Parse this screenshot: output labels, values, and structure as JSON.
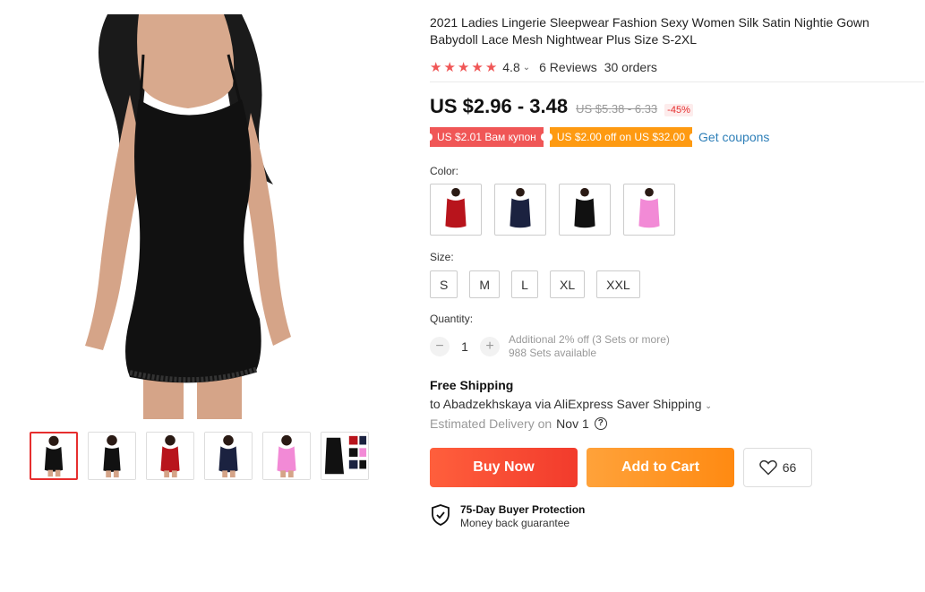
{
  "product": {
    "title": "2021 Ladies Lingerie Sleepwear Fashion Sexy Women Silk Satin Nightie Gown Babydoll Lace Mesh Nightwear Plus Size S-2XL",
    "rating": 4.8,
    "rating_text": "4.8",
    "rating_chevron": "⌄",
    "reviews": "6 Reviews",
    "orders": "30 orders",
    "price": "US $2.96 - 3.48",
    "old_price": "US $5.38 - 6.33",
    "discount": "-45%"
  },
  "coupons": {
    "red": "US $2.01 Вам купон",
    "orange": "US $2.00 off on US $32.00",
    "get": "Get coupons"
  },
  "color": {
    "label": "Color:",
    "options": [
      "red",
      "navy",
      "black",
      "pink"
    ]
  },
  "size": {
    "label": "Size:",
    "options": [
      "S",
      "M",
      "L",
      "XL",
      "XXL"
    ]
  },
  "quantity": {
    "label": "Quantity:",
    "minus": "−",
    "value": "1",
    "plus": "+",
    "note1": "Additional 2% off (3 Sets or more)",
    "note2": "988 Sets available"
  },
  "shipping": {
    "title": "Free Shipping",
    "to": "to Abadzekhskaya via AliExpress Saver Shipping",
    "chevron": "⌄",
    "delivery_label": "Estimated Delivery on",
    "delivery_date": "Nov 1",
    "help": "?"
  },
  "actions": {
    "buy": "Buy Now",
    "cart": "Add to Cart",
    "wishlist_count": "66"
  },
  "protection": {
    "title": "75-Day Buyer Protection",
    "subtitle": "Money back guarantee"
  },
  "colors": {
    "accent_red": "#f05656",
    "coupon_orange": "#fe9a11",
    "link_blue": "#2e7fb8",
    "dress_black": "#111111",
    "dress_red": "#b8141c",
    "dress_navy": "#1b2240",
    "dress_pink": "#f28ad6"
  },
  "thumbnails": [
    "black-front",
    "black-back",
    "red",
    "navy",
    "pink",
    "set-collage"
  ]
}
